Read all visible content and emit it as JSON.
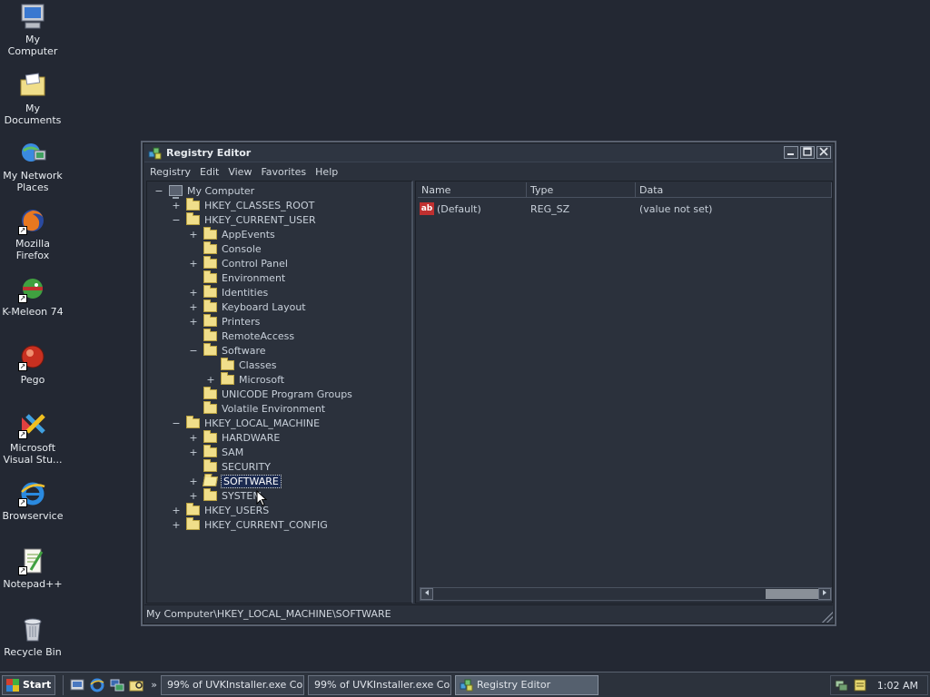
{
  "desktop": {
    "icons": [
      {
        "label": "My Computer",
        "icon": "computer-icon"
      },
      {
        "label": "My Documents",
        "icon": "documents-folder-icon"
      },
      {
        "label": "My Network Places",
        "icon": "network-icon"
      },
      {
        "label": "Mozilla Firefox",
        "icon": "firefox-icon"
      },
      {
        "label": "K-Meleon 74",
        "icon": "kmeleon-icon"
      },
      {
        "label": "Pego",
        "icon": "pego-icon"
      },
      {
        "label": "Microsoft Visual Stu...",
        "icon": "visual-studio-icon"
      },
      {
        "label": "Browservice",
        "icon": "ie-icon"
      },
      {
        "label": "Notepad++",
        "icon": "notepadpp-icon"
      },
      {
        "label": "Recycle Bin",
        "icon": "recycle-bin-icon"
      }
    ]
  },
  "window": {
    "title": "Registry Editor",
    "menu": [
      "Registry",
      "Edit",
      "View",
      "Favorites",
      "Help"
    ],
    "tree": [
      {
        "label": "My Computer",
        "expander": "−",
        "level": 0,
        "kind": "pc"
      },
      {
        "label": "HKEY_CLASSES_ROOT",
        "expander": "+",
        "level": 1
      },
      {
        "label": "HKEY_CURRENT_USER",
        "expander": "−",
        "level": 1
      },
      {
        "label": "AppEvents",
        "expander": "+",
        "level": 2
      },
      {
        "label": "Console",
        "expander": "",
        "level": 2
      },
      {
        "label": "Control Panel",
        "expander": "+",
        "level": 2
      },
      {
        "label": "Environment",
        "expander": "",
        "level": 2
      },
      {
        "label": "Identities",
        "expander": "+",
        "level": 2
      },
      {
        "label": "Keyboard Layout",
        "expander": "+",
        "level": 2
      },
      {
        "label": "Printers",
        "expander": "+",
        "level": 2
      },
      {
        "label": "RemoteAccess",
        "expander": "",
        "level": 2
      },
      {
        "label": "Software",
        "expander": "−",
        "level": 2
      },
      {
        "label": "Classes",
        "expander": "",
        "level": 3
      },
      {
        "label": "Microsoft",
        "expander": "+",
        "level": 3
      },
      {
        "label": "UNICODE Program Groups",
        "expander": "",
        "level": 2
      },
      {
        "label": "Volatile Environment",
        "expander": "",
        "level": 2
      },
      {
        "label": "HKEY_LOCAL_MACHINE",
        "expander": "−",
        "level": 1
      },
      {
        "label": "HARDWARE",
        "expander": "+",
        "level": 2
      },
      {
        "label": "SAM",
        "expander": "+",
        "level": 2
      },
      {
        "label": "SECURITY",
        "expander": "",
        "level": 2
      },
      {
        "label": "SOFTWARE",
        "expander": "+",
        "level": 2,
        "selected": true
      },
      {
        "label": "SYSTEM",
        "expander": "+",
        "level": 2
      },
      {
        "label": "HKEY_USERS",
        "expander": "+",
        "level": 1
      },
      {
        "label": "HKEY_CURRENT_CONFIG",
        "expander": "+",
        "level": 1
      }
    ],
    "list": {
      "columns": [
        "Name",
        "Type",
        "Data"
      ],
      "rows": [
        {
          "name": "(Default)",
          "type": "REG_SZ",
          "data": "(value not set)"
        }
      ]
    },
    "status": "My Computer\\HKEY_LOCAL_MACHINE\\SOFTWARE"
  },
  "taskbar": {
    "start_label": "Start",
    "tasks": [
      {
        "label": "99% of UVKInstaller.exe Co...",
        "active": false
      },
      {
        "label": "99% of UVKInstaller.exe Co...",
        "active": false
      },
      {
        "label": "Registry Editor",
        "active": true
      }
    ],
    "chevron": "»",
    "clock": "1:02 AM"
  }
}
